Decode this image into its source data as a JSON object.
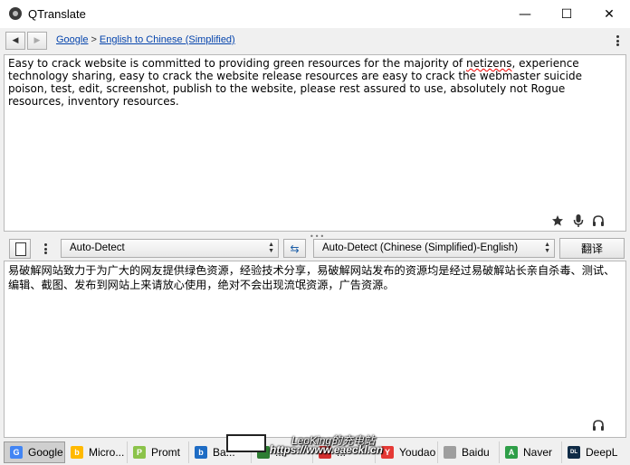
{
  "window": {
    "title": "QTranslate",
    "minimize_glyph": "—",
    "maximize_glyph": "☐",
    "close_glyph": "✕"
  },
  "nav": {
    "back_glyph": "◀",
    "forward_glyph": "▶",
    "breadcrumb_service": "Google",
    "breadcrumb_separator": ">",
    "breadcrumb_direction": "English to Chinese (Simplified)"
  },
  "source": {
    "text_before_misspelled": "Easy to crack website is committed to providing green resources for the majority of ",
    "misspelled_word": "netizens",
    "text_after_misspelled": ", experience technology sharing, easy to crack the website release resources are easy to crack the webmaster suicide poison, test, edit, screenshot, publish to the website, please rest assured to use, absolutely not Rogue resources, inventory resources.",
    "icons": [
      "star-icon",
      "microphone-icon",
      "headphones-icon"
    ]
  },
  "controls": {
    "source_language": "Auto-Detect",
    "target_language": "Auto-Detect (Chinese (Simplified)-English)",
    "swap_glyph": "⇆",
    "translate_label": "翻译",
    "select_arrows": "▲▼"
  },
  "result": {
    "text": "易破解网站致力于为广大的网友提供绿色资源，经验技术分享，易破解网站发布的资源均是经过易破解站长亲自杀毒、测试、编辑、截图、发布到网站上来请放心使用，绝对不会出现流氓资源，广告资源。",
    "icons": [
      "headphones-icon"
    ]
  },
  "splitter": {
    "glyph": "•••"
  },
  "services": [
    {
      "label": "Google",
      "icon_letter": "G",
      "color": "#4285f4",
      "active": true
    },
    {
      "label": "Micro...",
      "icon_letter": "b",
      "color": "#ffb900",
      "active": false
    },
    {
      "label": "Promt",
      "icon_letter": "P",
      "color": "#8bc34a",
      "active": false
    },
    {
      "label": "Ba...",
      "icon_letter": "b",
      "color": "#1e6cc4",
      "active": false
    },
    {
      "label": "...",
      "icon_letter": "",
      "color": "#2e7d32",
      "active": false
    },
    {
      "label": "...",
      "icon_letter": "",
      "color": "#d32f2f",
      "active": false
    },
    {
      "label": "Youdao",
      "icon_letter": "Y",
      "color": "#e53935",
      "active": false
    },
    {
      "label": "Baidu",
      "icon_letter": "",
      "color": "#999999",
      "active": false
    },
    {
      "label": "Naver",
      "icon_letter": "A",
      "color": "#2e9e48",
      "active": false
    },
    {
      "label": "DeepL",
      "icon_letter": "DL",
      "color": "#0f2b46",
      "active": false
    }
  ],
  "watermark": {
    "line1": "LeoKing的充电站",
    "line2": "https://www.eaeckl.cn"
  }
}
